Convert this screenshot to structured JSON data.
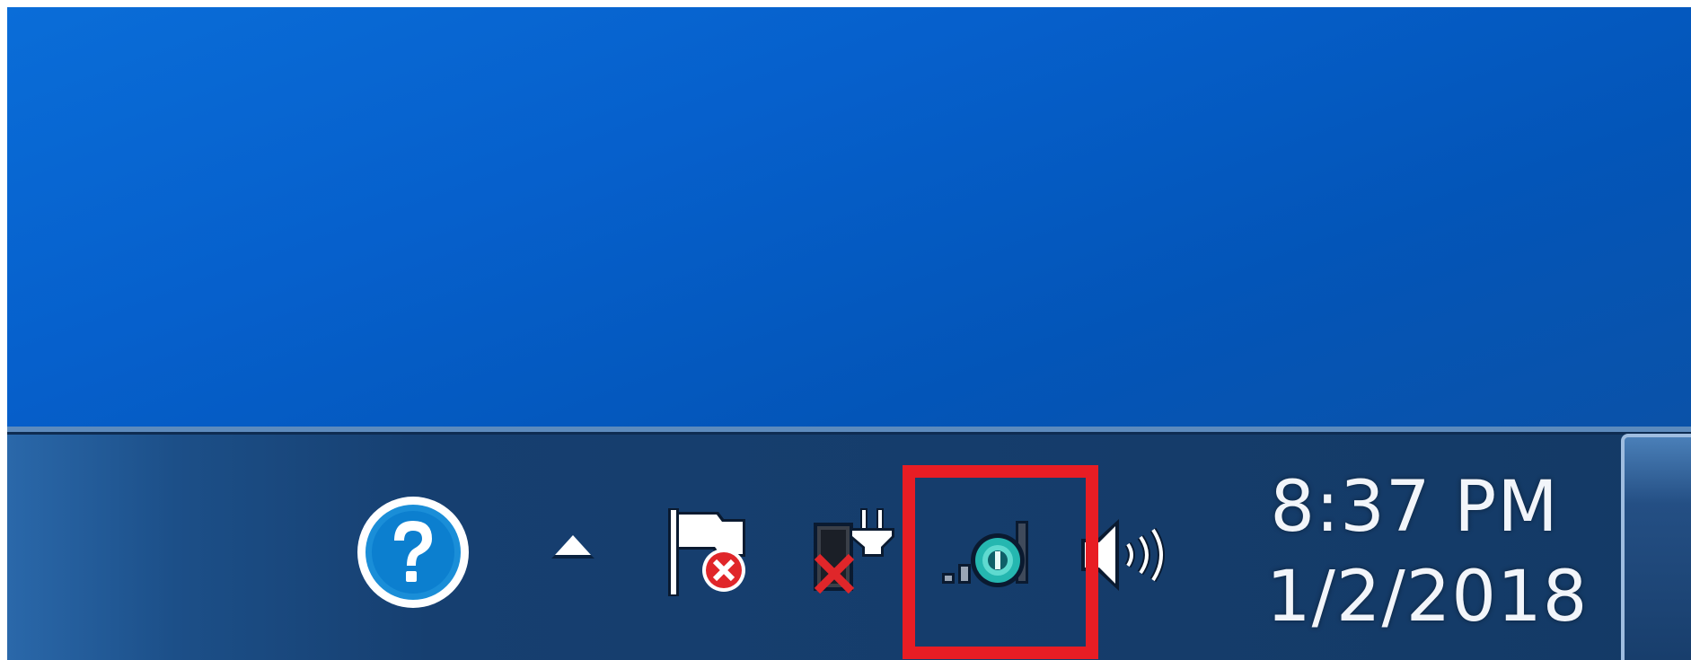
{
  "taskbar": {
    "clock": {
      "time": "8:37 PM",
      "date": "1/2/2018"
    },
    "tray_icons": [
      {
        "name": "help-icon",
        "interactable": true
      },
      {
        "name": "show-hidden-icons-arrow",
        "interactable": true
      },
      {
        "name": "action-center-flag-icon",
        "interactable": true
      },
      {
        "name": "power-plug-icon",
        "interactable": true
      },
      {
        "name": "network-icon",
        "interactable": true
      },
      {
        "name": "volume-icon",
        "interactable": true
      }
    ],
    "highlight_color": "#e81d24"
  },
  "colors": {
    "desktop": "#0660cc",
    "taskbar": "#143a66",
    "clock_text": "#f2f5fa"
  }
}
